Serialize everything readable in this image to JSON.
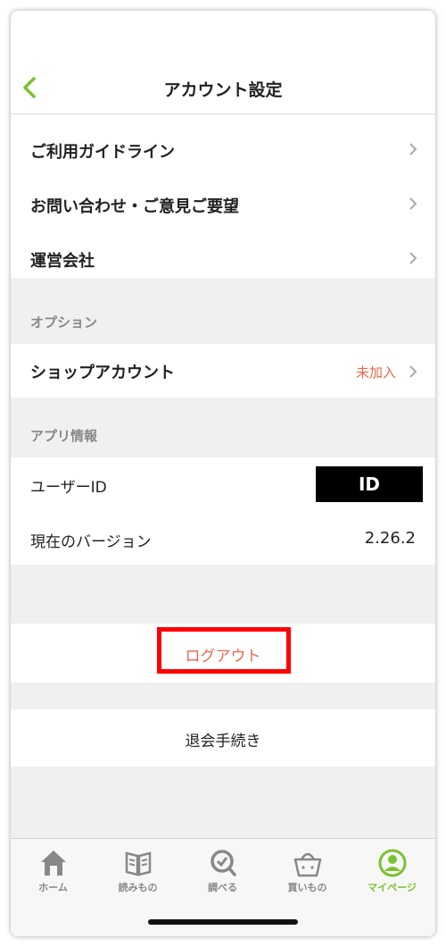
{
  "header": {
    "title": "アカウント設定"
  },
  "menu": {
    "guideline": "ご利用ガイドライン",
    "contact": "お問い合わせ・ご意見ご要望",
    "company": "運営会社"
  },
  "option": {
    "section": "オプション",
    "shop_account": "ショップアカウント",
    "shop_status": "未加入"
  },
  "app_info": {
    "section": "アプリ情報",
    "user_id_label": "ユーザーID",
    "user_id_value": "ID",
    "version_label": "現在のバージョン",
    "version_value": "2.26.2"
  },
  "actions": {
    "logout": "ログアウト",
    "withdraw": "退会手続き"
  },
  "tabs": [
    {
      "label": "ホーム",
      "icon": "home-icon"
    },
    {
      "label": "読みもの",
      "icon": "book-icon"
    },
    {
      "label": "調べる",
      "icon": "search-icon"
    },
    {
      "label": "買いもの",
      "icon": "basket-icon"
    },
    {
      "label": "マイページ",
      "icon": "user-icon",
      "active": true
    }
  ],
  "colors": {
    "accent": "#7ac231",
    "status": "#e86a4a",
    "highlight": "#ff0000"
  }
}
